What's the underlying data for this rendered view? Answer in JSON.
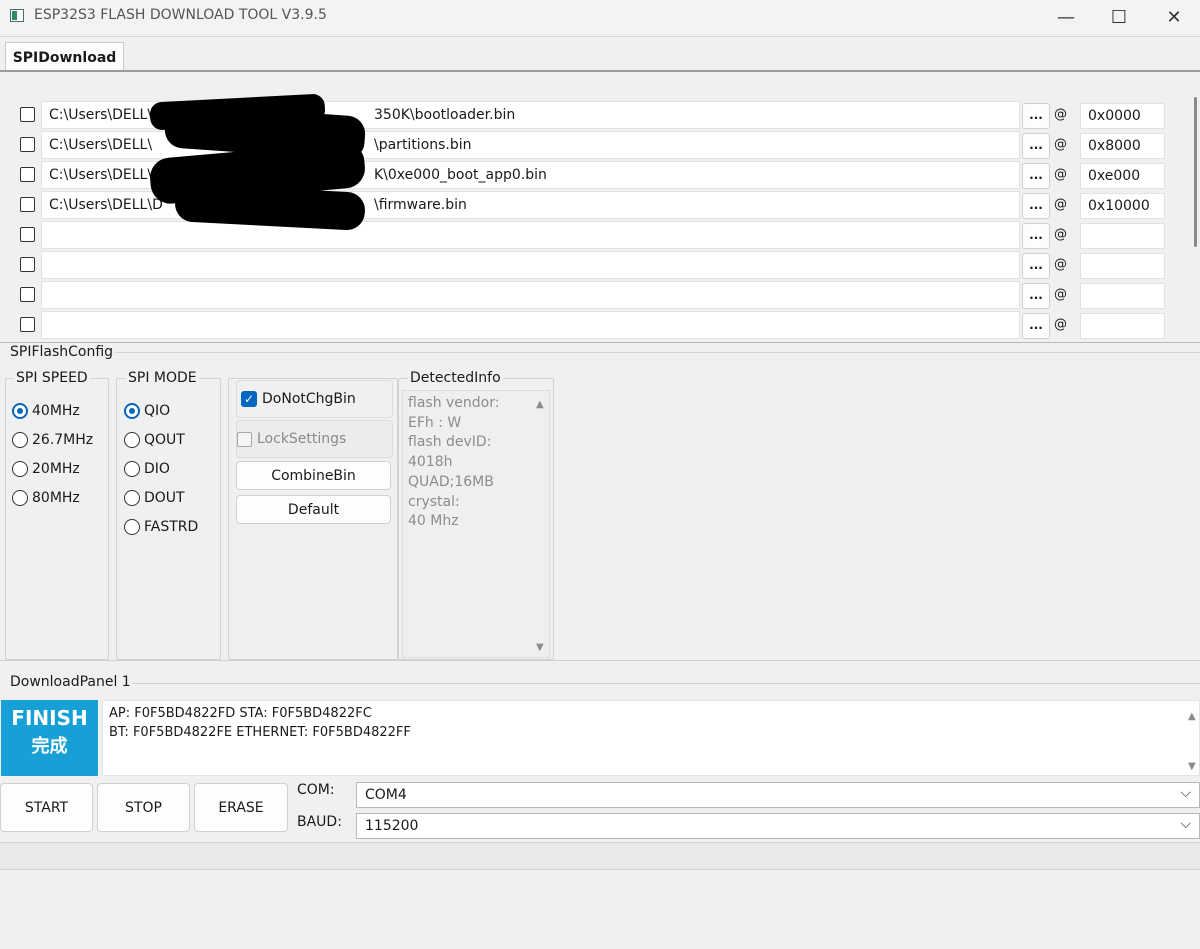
{
  "window": {
    "title": "ESP32S3 FLASH DOWNLOAD TOOL V3.9.5",
    "minimize_glyph": "—",
    "maximize_glyph": "☐",
    "close_glyph": "✕"
  },
  "tabs": [
    {
      "label": "SPIDownload",
      "active": true
    }
  ],
  "files": {
    "browse_label": "...",
    "at_label": "@",
    "rows": [
      {
        "checked": false,
        "path": "C:\\Users\\DELL\\D",
        "path_end": "350K\\bootloader.bin",
        "offset": "0x0000"
      },
      {
        "checked": false,
        "path": "C:\\Users\\DELL\\",
        "path_end": "\\partitions.bin",
        "offset": "0x8000"
      },
      {
        "checked": false,
        "path": "C:\\Users\\DELL\\Do",
        "path_end": "K\\0xe000_boot_app0.bin",
        "offset": "0xe000"
      },
      {
        "checked": false,
        "path": "C:\\Users\\DELL\\D",
        "path_end": "\\firmware.bin",
        "offset": "0x10000"
      },
      {
        "checked": false,
        "path": "",
        "path_end": "",
        "offset": ""
      },
      {
        "checked": false,
        "path": "",
        "path_end": "",
        "offset": ""
      },
      {
        "checked": false,
        "path": "",
        "path_end": "",
        "offset": ""
      },
      {
        "checked": false,
        "path": "",
        "path_end": "",
        "offset": ""
      }
    ]
  },
  "spi_flash_config": {
    "label": "SPIFlashConfig",
    "speed": {
      "title": "SPI SPEED",
      "options": [
        "40MHz",
        "26.7MHz",
        "20MHz",
        "80MHz"
      ],
      "selected": "40MHz"
    },
    "mode": {
      "title": "SPI MODE",
      "options": [
        "QIO",
        "QOUT",
        "DIO",
        "DOUT",
        "FASTRD"
      ],
      "selected": "QIO"
    },
    "do_not_chg_bin": {
      "label": "DoNotChgBin",
      "checked": true
    },
    "lock_settings": {
      "label": "LockSettings",
      "checked": false
    },
    "combine_bin_label": "CombineBin",
    "default_label": "Default",
    "detected_info": {
      "title": "DetectedInfo",
      "lines": [
        "flash vendor:",
        "EFh : W",
        "flash devID:",
        "4018h",
        "QUAD;16MB",
        "crystal:",
        "40 Mhz"
      ]
    }
  },
  "download_panel": {
    "label": "DownloadPanel 1",
    "status_en": "FINISH",
    "status_cn": "完成",
    "status_color": "#17a0d6",
    "log_lines": [
      "AP:  F0F5BD4822FD  STA:  F0F5BD4822FC",
      "BT:  F0F5BD4822FE  ETHERNET:  F0F5BD4822FF"
    ]
  },
  "controls": {
    "start_label": "START",
    "stop_label": "STOP",
    "erase_label": "ERASE",
    "com_label": "COM:",
    "com_value": "COM4",
    "baud_label": "BAUD:",
    "baud_value": "115200"
  }
}
